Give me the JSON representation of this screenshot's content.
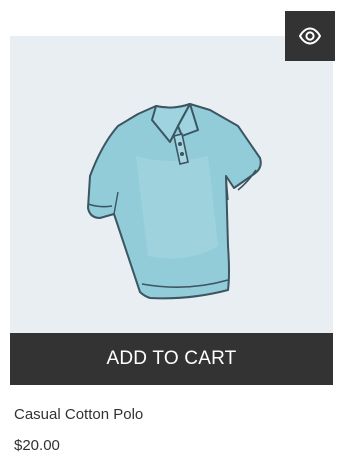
{
  "product": {
    "title": "Casual Cotton Polo",
    "price": "$20.00",
    "image_alt": "Light blue polo shirt"
  },
  "actions": {
    "add_to_cart_label": "ADD TO CART",
    "quick_view_icon": "eye-icon"
  },
  "colors": {
    "button_bg": "#333333",
    "image_bg": "#e9eef2",
    "shirt_fill": "#93ccd9",
    "text": "#333333"
  }
}
